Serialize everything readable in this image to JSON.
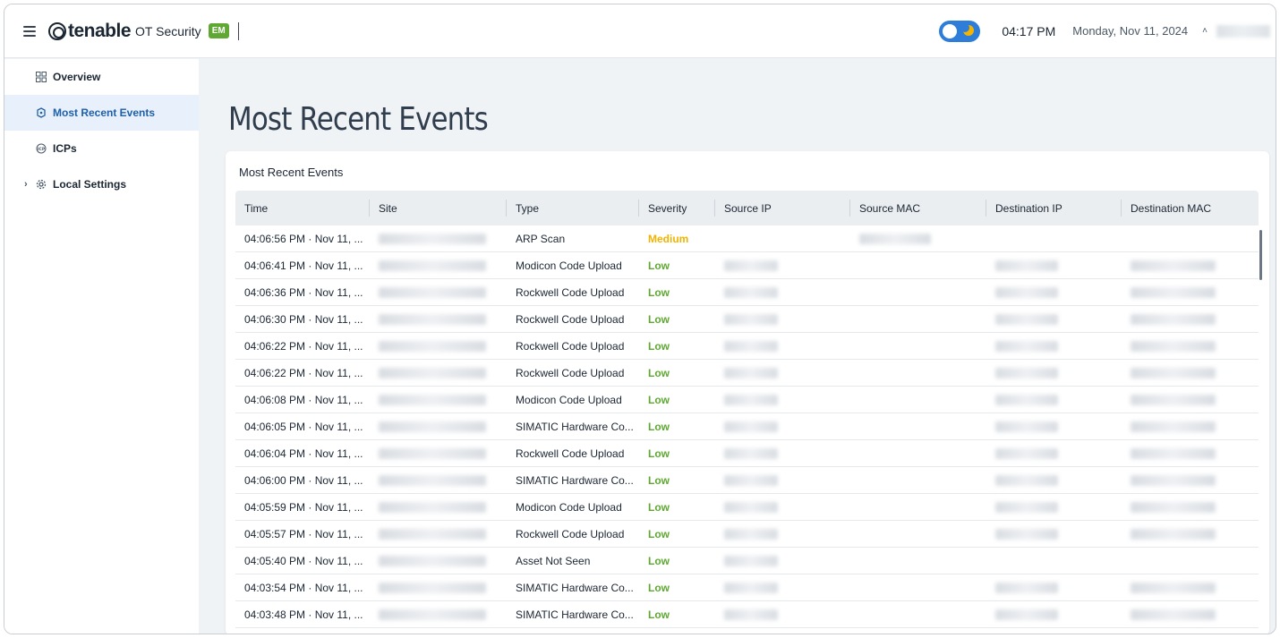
{
  "header": {
    "brand": "tenable",
    "product": "OT Security",
    "badge": "EM",
    "time": "04:17 PM",
    "date": "Monday, Nov 11, 2024",
    "accent": "#2e7dd8"
  },
  "sidebar": {
    "items": [
      {
        "label": "Overview",
        "icon": "grid-icon"
      },
      {
        "label": "Most Recent Events",
        "icon": "alert-icon"
      },
      {
        "label": "ICPs",
        "icon": "icp-icon"
      },
      {
        "label": "Local Settings",
        "icon": "settings-icon"
      }
    ]
  },
  "main": {
    "page_title": "Most Recent Events",
    "card_title": "Most Recent Events",
    "columns": [
      "Time",
      "Site",
      "Type",
      "Severity",
      "Source IP",
      "Source MAC",
      "Destination IP",
      "Destination MAC"
    ],
    "rows": [
      {
        "time": "04:06:56 PM · Nov 11, ...",
        "type": "ARP Scan",
        "severity": "Medium"
      },
      {
        "time": "04:06:41 PM · Nov 11, ...",
        "type": "Modicon Code Upload",
        "severity": "Low"
      },
      {
        "time": "04:06:36 PM · Nov 11, ...",
        "type": "Rockwell Code Upload",
        "severity": "Low"
      },
      {
        "time": "04:06:30 PM · Nov 11, ...",
        "type": "Rockwell Code Upload",
        "severity": "Low"
      },
      {
        "time": "04:06:22 PM · Nov 11, ...",
        "type": "Rockwell Code Upload",
        "severity": "Low"
      },
      {
        "time": "04:06:22 PM · Nov 11, ...",
        "type": "Rockwell Code Upload",
        "severity": "Low"
      },
      {
        "time": "04:06:08 PM · Nov 11, ...",
        "type": "Modicon Code Upload",
        "severity": "Low"
      },
      {
        "time": "04:06:05 PM · Nov 11, ...",
        "type": "SIMATIC Hardware Co...",
        "severity": "Low"
      },
      {
        "time": "04:06:04 PM · Nov 11, ...",
        "type": "Rockwell Code Upload",
        "severity": "Low"
      },
      {
        "time": "04:06:00 PM · Nov 11, ...",
        "type": "SIMATIC Hardware Co...",
        "severity": "Low"
      },
      {
        "time": "04:05:59 PM · Nov 11, ...",
        "type": "Modicon Code Upload",
        "severity": "Low"
      },
      {
        "time": "04:05:57 PM · Nov 11, ...",
        "type": "Rockwell Code Upload",
        "severity": "Low"
      },
      {
        "time": "04:05:40 PM · Nov 11, ...",
        "type": "Asset Not Seen",
        "severity": "Low"
      },
      {
        "time": "04:03:54 PM · Nov 11, ...",
        "type": "SIMATIC Hardware Co...",
        "severity": "Low"
      },
      {
        "time": "04:03:48 PM · Nov 11, ...",
        "type": "SIMATIC Hardware Co...",
        "severity": "Low"
      }
    ]
  }
}
